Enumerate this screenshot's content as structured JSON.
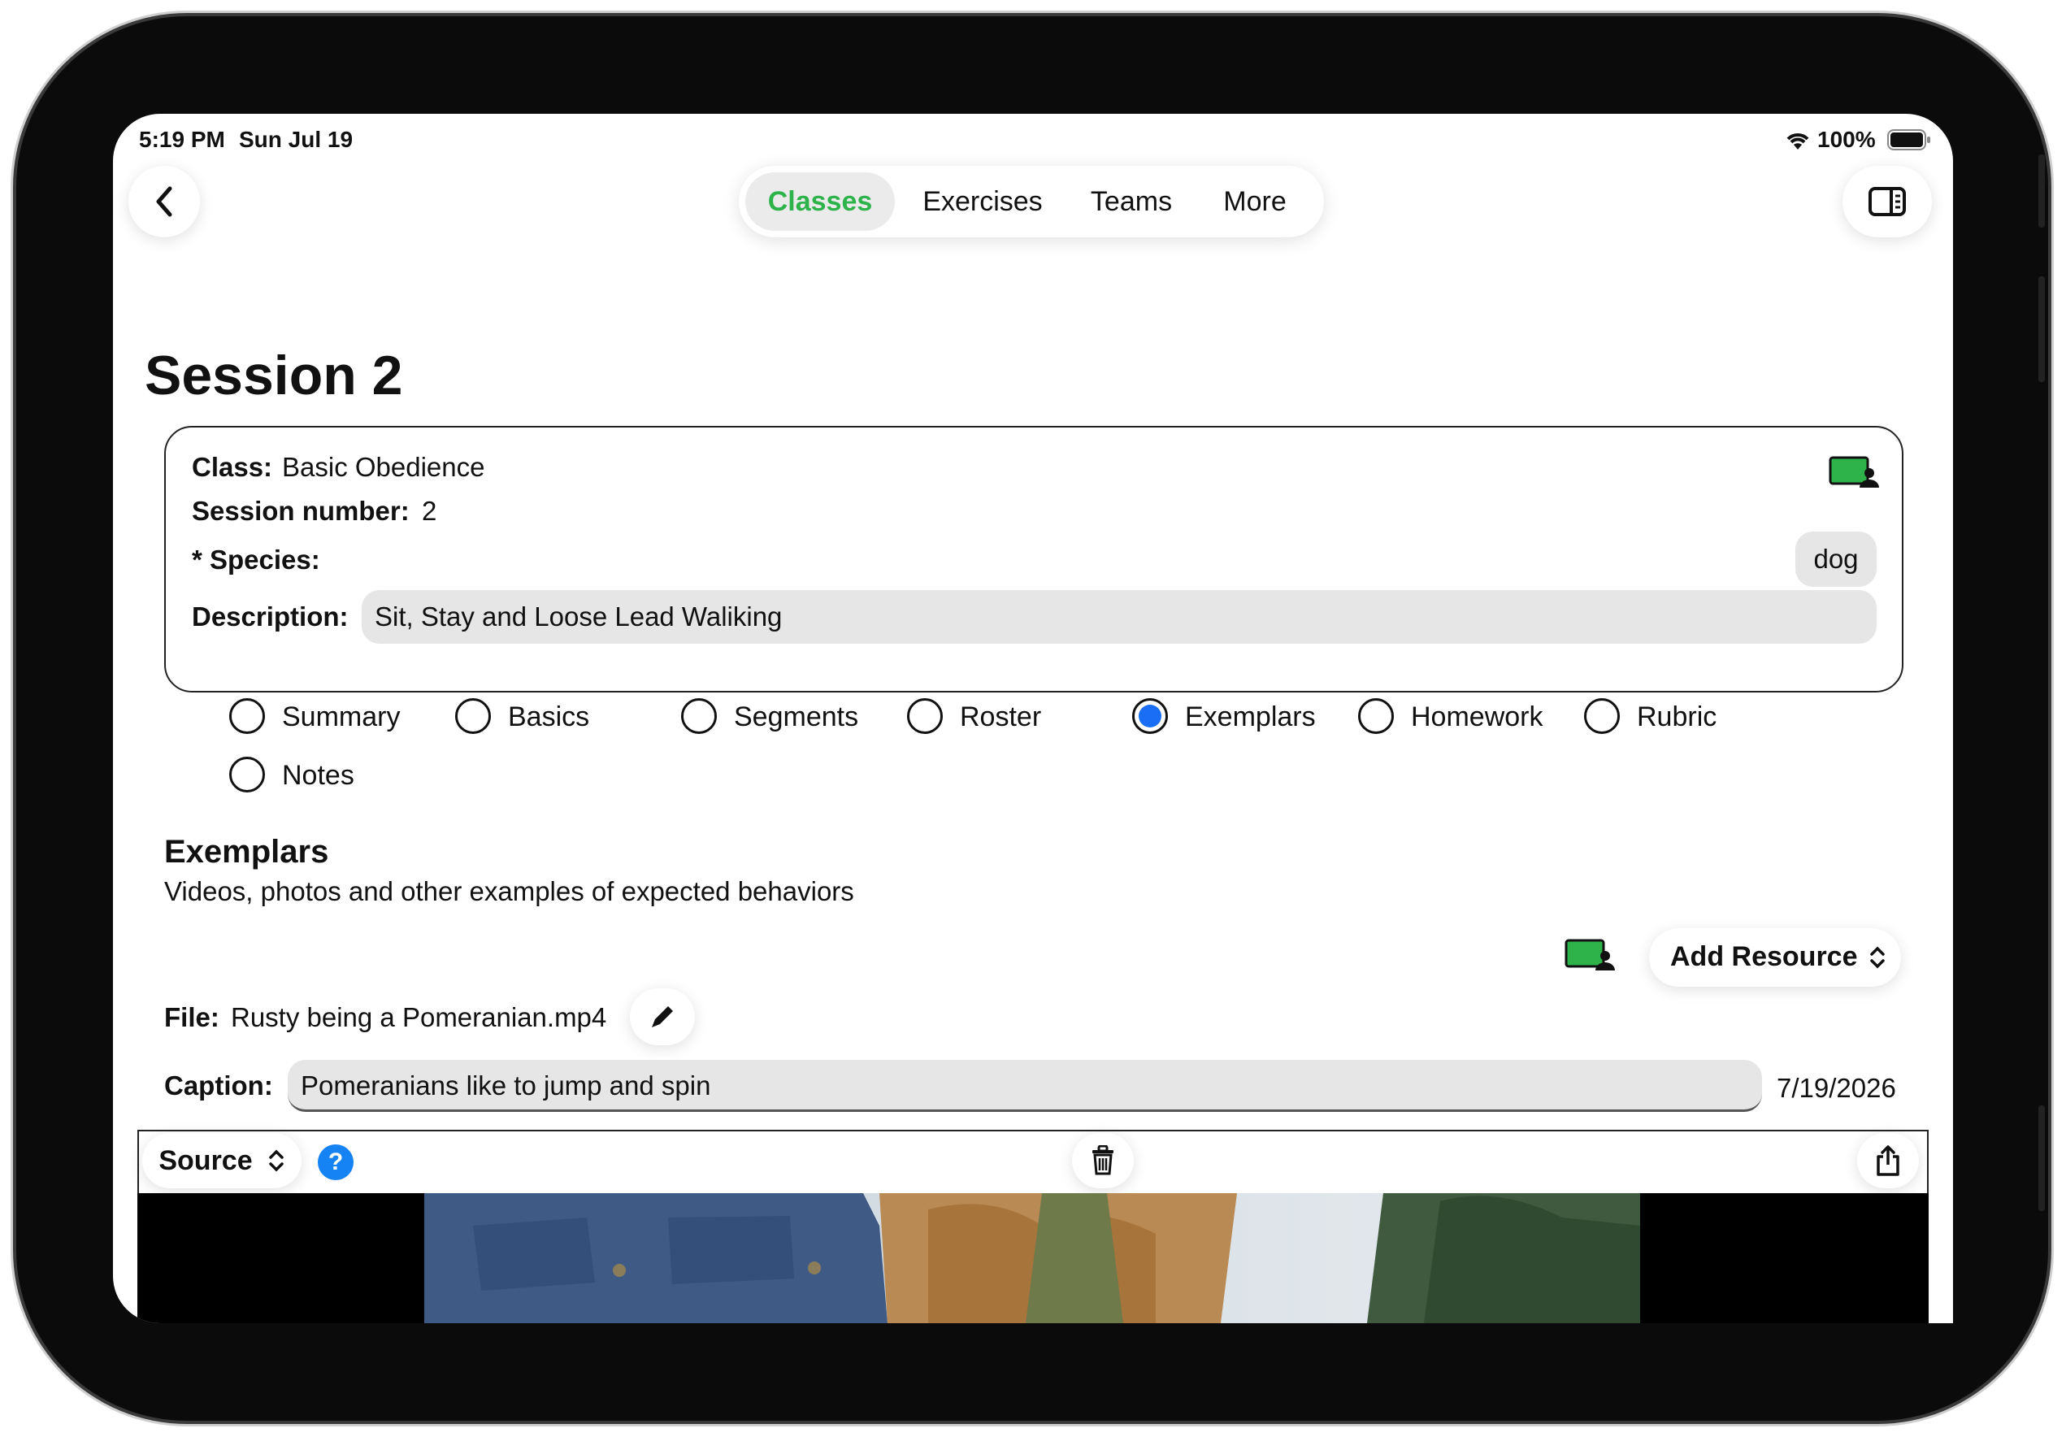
{
  "status": {
    "time": "5:19 PM",
    "date": "Sun Jul 19",
    "battery": "100%"
  },
  "nav": {
    "tabs": [
      {
        "label": "Classes",
        "active": true
      },
      {
        "label": "Exercises",
        "active": false
      },
      {
        "label": "Teams",
        "active": false
      },
      {
        "label": "More",
        "active": false
      }
    ],
    "back_icon": "chevron-left-icon",
    "sidebar_icon": "sidebar-right-icon"
  },
  "page": {
    "title": "Session 2"
  },
  "session": {
    "class_label": "Class:",
    "class_value": "Basic Obedience",
    "number_label": "Session number:",
    "number_value": "2",
    "species_label": "* Species:",
    "species_value": "dog",
    "description_label": "Description:",
    "description_value": "Sit, Stay and Loose Lead Waliking"
  },
  "sections": [
    {
      "label": "Summary",
      "selected": false
    },
    {
      "label": "Basics",
      "selected": false
    },
    {
      "label": "Segments",
      "selected": false
    },
    {
      "label": "Roster",
      "selected": false
    },
    {
      "label": "Exemplars",
      "selected": true
    },
    {
      "label": "Homework",
      "selected": false
    },
    {
      "label": "Rubric",
      "selected": false
    },
    {
      "label": "Notes",
      "selected": false
    }
  ],
  "exemplars": {
    "heading": "Exemplars",
    "subheading": "Videos, photos and other examples of expected behaviors",
    "add_resource": "Add Resource",
    "file_label": "File:",
    "file_value": "Rusty being a Pomeranian.mp4",
    "caption_label": "Caption:",
    "caption_value": "Pomeranians like to jump and spin",
    "date": "7/19/2026",
    "source_label": "Source",
    "help_glyph": "?"
  },
  "colors": {
    "accent_green": "#2db34a",
    "radio_blue": "#1a6ef5",
    "help_blue": "#1683f5",
    "pill_gray": "#e6e6e6"
  }
}
